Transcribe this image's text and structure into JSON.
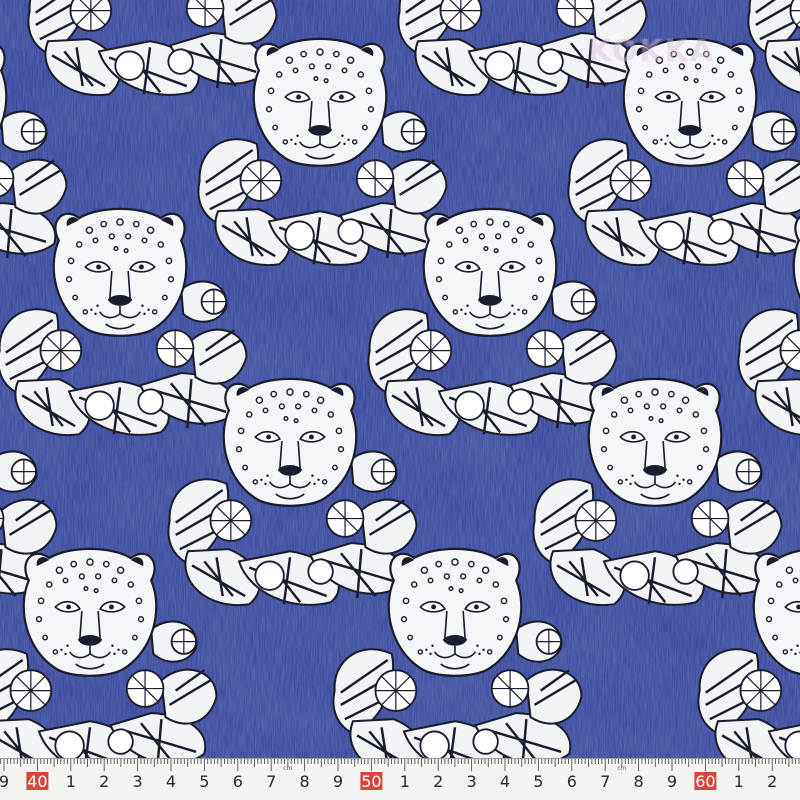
{
  "photo": {
    "subject": "",
    "colors": {
      "denim": "#3a4c9e",
      "denim_dark": "#2e3f8c",
      "print_white": "#f3f4f6",
      "print_ink": "#1a1d2e",
      "ruler_bg": "#f4f4f2",
      "ruler_major_red": "#d9453a"
    }
  },
  "watermark": {
    "text": "KOKKA"
  },
  "ruler": {
    "labels": [
      "9",
      "40",
      "1",
      "2",
      "3",
      "4",
      "5",
      "6",
      "7",
      "8",
      "9",
      "50",
      "1",
      "2",
      "3",
      "4",
      "5",
      "6",
      "7",
      "8",
      "9",
      "60",
      "1",
      "2"
    ],
    "major": [
      "40",
      "50",
      "60"
    ],
    "unit_marks": [
      "cm",
      "cm"
    ]
  }
}
